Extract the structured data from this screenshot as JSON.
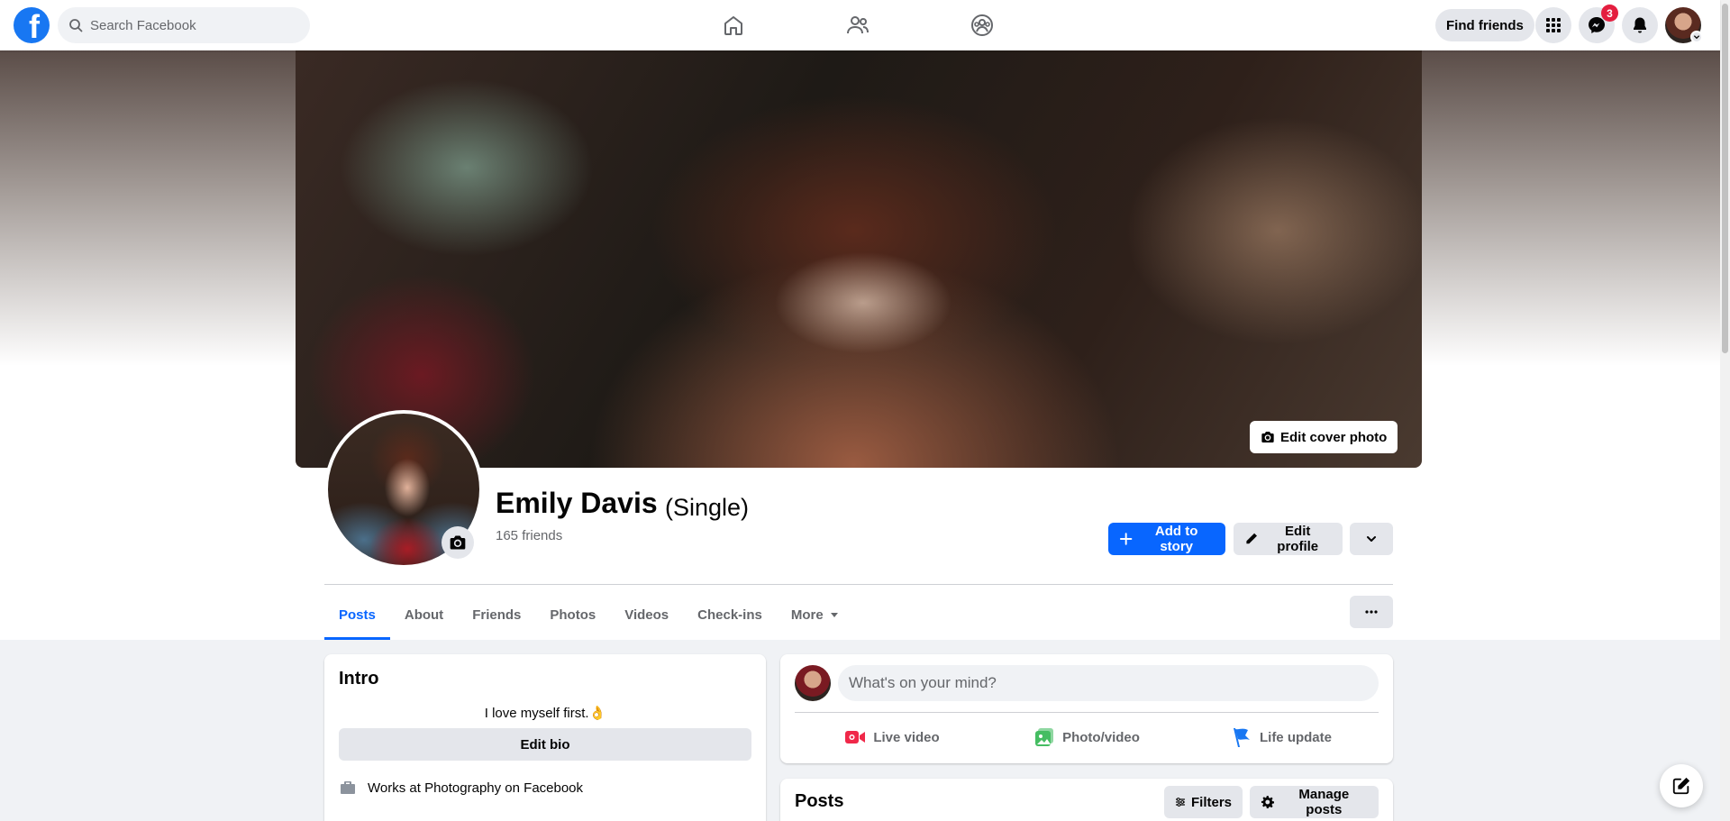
{
  "topbar": {
    "logo_letter": "f",
    "search_placeholder": "Search Facebook",
    "find_friends_label": "Find friends",
    "messenger_badge": "3",
    "icons": [
      "home-icon",
      "friends-icon",
      "groups-icon",
      "menu-grid-icon",
      "messenger-icon",
      "bell-icon"
    ]
  },
  "cover": {
    "edit_cover_label": "Edit cover photo"
  },
  "profile": {
    "name": "Emily Davis",
    "relationship": "(Single)",
    "friends_count": "165 friends",
    "add_story_label": "Add to story",
    "edit_profile_label": "Edit profile"
  },
  "tabs": [
    {
      "label": "Posts",
      "active": true
    },
    {
      "label": "About"
    },
    {
      "label": "Friends"
    },
    {
      "label": "Photos"
    },
    {
      "label": "Videos"
    },
    {
      "label": "Check-ins"
    },
    {
      "label": "More"
    }
  ],
  "intro": {
    "title": "Intro",
    "bio": "I love myself first.👌",
    "edit_bio_label": "Edit bio",
    "work": "Works at Photography on Facebook"
  },
  "composer": {
    "placeholder": "What's on your mind?",
    "actions": [
      {
        "label": "Live video",
        "color": "#f02849"
      },
      {
        "label": "Photo/video",
        "color": "#45bd62"
      },
      {
        "label": "Life update",
        "color": "#1877f2"
      }
    ]
  },
  "posts": {
    "title": "Posts",
    "filters_label": "Filters",
    "manage_label": "Manage posts"
  },
  "colors": {
    "brand": "#1877f2",
    "primary_button": "#0866ff",
    "badge": "#e41e3f"
  }
}
